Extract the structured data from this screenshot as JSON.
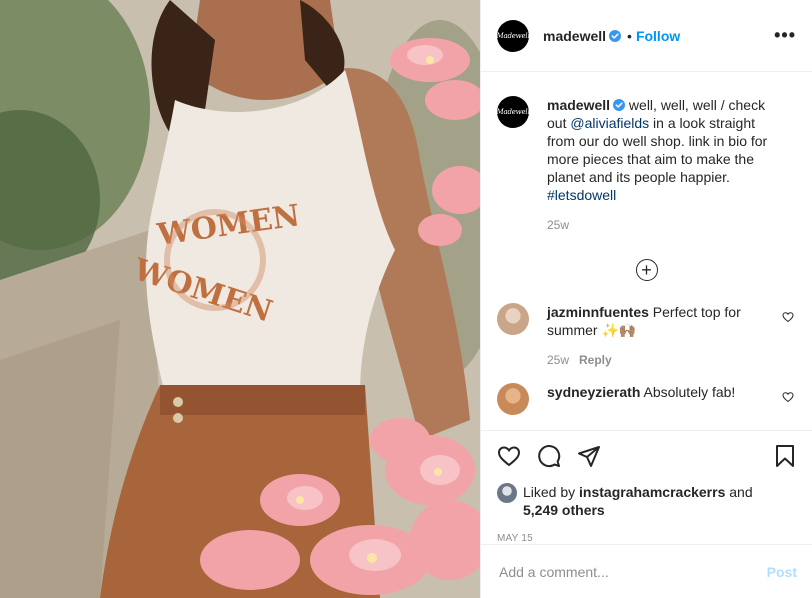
{
  "colors": {
    "link_blue": "#0095f6",
    "mention_dark": "#00376b",
    "muted_gray": "#8e8e8e",
    "post_disabled": "#b2dffc",
    "verified_blue": "#3897f0"
  },
  "photo": {
    "description_icon": "photo-woman-white-tank-top-flowers",
    "shirt_text": "WOMEN WOMEN"
  },
  "header": {
    "avatar_text": "Madewell",
    "username": "madewell",
    "separator": "•",
    "follow_label": "Follow",
    "more_label": "•••"
  },
  "caption": {
    "avatar_text": "Madewell",
    "username": "madewell",
    "text_before": " well, well, well / check out ",
    "mention": "@aliviafields",
    "text_after": " in a look straight from our do well shop. link in bio for more pieces that aim to make the planet and its people happier. ",
    "hashtag": "#letsdowell",
    "time": "25w"
  },
  "load_more_icon": "plus-circle-icon",
  "comments": [
    {
      "username": "jazminnfuentes",
      "text": " Perfect top for summer ",
      "emoji": "✨🙌🏽",
      "time": "25w",
      "reply_label": "Reply",
      "avatar_color": "#c9a58a"
    },
    {
      "username": "sydneyzierath",
      "text": " Absolutely fab!",
      "avatar_color": "#c98a5a"
    }
  ],
  "actions": {
    "like_icon": "heart-icon",
    "comment_icon": "comment-icon",
    "share_icon": "paper-plane-icon",
    "save_icon": "bookmark-icon"
  },
  "likes": {
    "prefix": "Liked by ",
    "user": "instagrahamcrackerrs",
    "middle": " and",
    "count": "5,249 others"
  },
  "date": "MAY 15",
  "add_comment": {
    "placeholder": "Add a comment...",
    "post_label": "Post"
  }
}
